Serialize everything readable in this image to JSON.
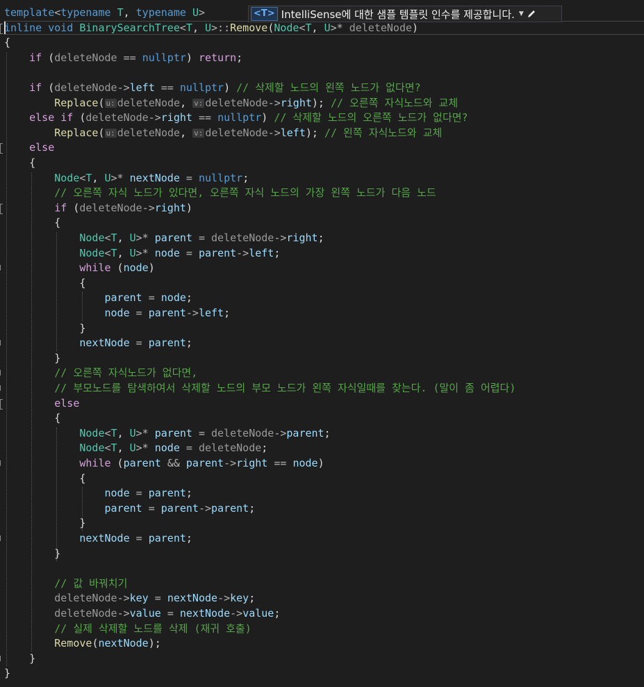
{
  "intellisense": {
    "badge": "<T>",
    "message": "IntelliSense에 대한 샘플 템플릿 인수를 제공합니다."
  },
  "hint_labels": {
    "u": "u:",
    "v": "v:"
  },
  "code": {
    "lines": [
      [
        [
          "kw",
          "template"
        ],
        [
          "op",
          "<"
        ],
        [
          "kw",
          "typename"
        ],
        [
          "pl",
          " "
        ],
        [
          "type",
          "T"
        ],
        [
          "pl",
          ", "
        ],
        [
          "kw",
          "typename"
        ],
        [
          "pl",
          " "
        ],
        [
          "type",
          "U"
        ],
        [
          "op",
          ">"
        ]
      ],
      [
        [
          "kw",
          "inline"
        ],
        [
          "pl",
          " "
        ],
        [
          "kw",
          "void"
        ],
        [
          "pl",
          " "
        ],
        [
          "type",
          "BinarySearchTree"
        ],
        [
          "op",
          "<"
        ],
        [
          "type",
          "T"
        ],
        [
          "pl",
          ", "
        ],
        [
          "type",
          "U"
        ],
        [
          "op",
          ">::"
        ],
        [
          "fn",
          "Remove"
        ],
        [
          "pl",
          "("
        ],
        [
          "type",
          "Node"
        ],
        [
          "op",
          "<"
        ],
        [
          "type",
          "T"
        ],
        [
          "pl",
          ", "
        ],
        [
          "type",
          "U"
        ],
        [
          "op",
          ">*"
        ],
        [
          "pl",
          " "
        ],
        [
          "param",
          "deleteNode"
        ],
        [
          "pl",
          ")"
        ]
      ],
      [
        [
          "pl",
          "{"
        ]
      ],
      [
        [
          "pl",
          "    "
        ],
        [
          "ctrl",
          "if"
        ],
        [
          "pl",
          " ("
        ],
        [
          "param",
          "deleteNode"
        ],
        [
          "pl",
          " "
        ],
        [
          "op",
          "=="
        ],
        [
          "pl",
          " "
        ],
        [
          "kw",
          "nullptr"
        ],
        [
          "pl",
          ") "
        ],
        [
          "ctrl",
          "return"
        ],
        [
          "pl",
          ";"
        ]
      ],
      [],
      [
        [
          "pl",
          "    "
        ],
        [
          "ctrl",
          "if"
        ],
        [
          "pl",
          " ("
        ],
        [
          "param",
          "deleteNode"
        ],
        [
          "op",
          "->"
        ],
        [
          "var",
          "left"
        ],
        [
          "pl",
          " "
        ],
        [
          "op",
          "=="
        ],
        [
          "pl",
          " "
        ],
        [
          "kw",
          "nullptr"
        ],
        [
          "pl",
          ") "
        ],
        [
          "cm",
          "// 삭제할 노드의 왼쪽 노드가 없다면?"
        ]
      ],
      [
        [
          "pl",
          "        "
        ],
        [
          "fn",
          "Replace"
        ],
        [
          "pl",
          "("
        ],
        [
          "hint",
          "u"
        ],
        [
          "param",
          "deleteNode"
        ],
        [
          "pl",
          ", "
        ],
        [
          "hint",
          "v"
        ],
        [
          "param",
          "deleteNode"
        ],
        [
          "op",
          "->"
        ],
        [
          "var",
          "right"
        ],
        [
          "pl",
          "); "
        ],
        [
          "cm",
          "// 오른쪽 자식노드와 교체"
        ]
      ],
      [
        [
          "pl",
          "    "
        ],
        [
          "ctrl",
          "else"
        ],
        [
          "pl",
          " "
        ],
        [
          "ctrl",
          "if"
        ],
        [
          "pl",
          " ("
        ],
        [
          "param",
          "deleteNode"
        ],
        [
          "op",
          "->"
        ],
        [
          "var",
          "right"
        ],
        [
          "pl",
          " "
        ],
        [
          "op",
          "=="
        ],
        [
          "pl",
          " "
        ],
        [
          "kw",
          "nullptr"
        ],
        [
          "pl",
          ") "
        ],
        [
          "cm",
          "// 삭제할 노드의 오른쪽 노드가 없다면?"
        ]
      ],
      [
        [
          "pl",
          "        "
        ],
        [
          "fn",
          "Replace"
        ],
        [
          "pl",
          "("
        ],
        [
          "hint",
          "u"
        ],
        [
          "param",
          "deleteNode"
        ],
        [
          "pl",
          ", "
        ],
        [
          "hint",
          "v"
        ],
        [
          "param",
          "deleteNode"
        ],
        [
          "op",
          "->"
        ],
        [
          "var",
          "left"
        ],
        [
          "pl",
          "); "
        ],
        [
          "cm",
          "// 왼쪽 자식노드와 교체"
        ]
      ],
      [
        [
          "pl",
          "    "
        ],
        [
          "ctrl",
          "else"
        ]
      ],
      [
        [
          "pl",
          "    {"
        ]
      ],
      [
        [
          "pl",
          "        "
        ],
        [
          "type",
          "Node"
        ],
        [
          "op",
          "<"
        ],
        [
          "type",
          "T"
        ],
        [
          "pl",
          ", "
        ],
        [
          "type",
          "U"
        ],
        [
          "op",
          ">*"
        ],
        [
          "pl",
          " "
        ],
        [
          "var",
          "nextNode"
        ],
        [
          "pl",
          " "
        ],
        [
          "op",
          "="
        ],
        [
          "pl",
          " "
        ],
        [
          "kw",
          "nullptr"
        ],
        [
          "pl",
          ";"
        ]
      ],
      [
        [
          "pl",
          "        "
        ],
        [
          "cm",
          "// 오른쪽 자식 노드가 있다면, 오른쪽 자식 노드의 가장 왼쪽 노드가 다음 노드"
        ]
      ],
      [
        [
          "pl",
          "        "
        ],
        [
          "ctrl",
          "if"
        ],
        [
          "pl",
          " ("
        ],
        [
          "param",
          "deleteNode"
        ],
        [
          "op",
          "->"
        ],
        [
          "var",
          "right"
        ],
        [
          "pl",
          ")"
        ]
      ],
      [
        [
          "pl",
          "        {"
        ]
      ],
      [
        [
          "pl",
          "            "
        ],
        [
          "type",
          "Node"
        ],
        [
          "op",
          "<"
        ],
        [
          "type",
          "T"
        ],
        [
          "pl",
          ", "
        ],
        [
          "type",
          "U"
        ],
        [
          "op",
          ">*"
        ],
        [
          "pl",
          " "
        ],
        [
          "var",
          "parent"
        ],
        [
          "pl",
          " "
        ],
        [
          "op",
          "="
        ],
        [
          "pl",
          " "
        ],
        [
          "param",
          "deleteNode"
        ],
        [
          "op",
          "->"
        ],
        [
          "var",
          "right"
        ],
        [
          "pl",
          ";"
        ]
      ],
      [
        [
          "pl",
          "            "
        ],
        [
          "type",
          "Node"
        ],
        [
          "op",
          "<"
        ],
        [
          "type",
          "T"
        ],
        [
          "pl",
          ", "
        ],
        [
          "type",
          "U"
        ],
        [
          "op",
          ">*"
        ],
        [
          "pl",
          " "
        ],
        [
          "var",
          "node"
        ],
        [
          "pl",
          " "
        ],
        [
          "op",
          "="
        ],
        [
          "pl",
          " "
        ],
        [
          "var",
          "parent"
        ],
        [
          "op",
          "->"
        ],
        [
          "var",
          "left"
        ],
        [
          "pl",
          ";"
        ]
      ],
      [
        [
          "pl",
          "            "
        ],
        [
          "ctrl",
          "while"
        ],
        [
          "pl",
          " ("
        ],
        [
          "var",
          "node"
        ],
        [
          "pl",
          ")"
        ]
      ],
      [
        [
          "pl",
          "            {"
        ]
      ],
      [
        [
          "pl",
          "                "
        ],
        [
          "var",
          "parent"
        ],
        [
          "pl",
          " "
        ],
        [
          "op",
          "="
        ],
        [
          "pl",
          " "
        ],
        [
          "var",
          "node"
        ],
        [
          "pl",
          ";"
        ]
      ],
      [
        [
          "pl",
          "                "
        ],
        [
          "var",
          "node"
        ],
        [
          "pl",
          " "
        ],
        [
          "op",
          "="
        ],
        [
          "pl",
          " "
        ],
        [
          "var",
          "parent"
        ],
        [
          "op",
          "->"
        ],
        [
          "var",
          "left"
        ],
        [
          "pl",
          ";"
        ]
      ],
      [
        [
          "pl",
          "            }"
        ]
      ],
      [
        [
          "pl",
          "            "
        ],
        [
          "var",
          "nextNode"
        ],
        [
          "pl",
          " "
        ],
        [
          "op",
          "="
        ],
        [
          "pl",
          " "
        ],
        [
          "var",
          "parent"
        ],
        [
          "pl",
          ";"
        ]
      ],
      [
        [
          "pl",
          "        }"
        ]
      ],
      [
        [
          "pl",
          "        "
        ],
        [
          "cm",
          "// 오른쪽 자식노드가 없다면,"
        ]
      ],
      [
        [
          "pl",
          "        "
        ],
        [
          "cm",
          "// 부모노드를 탐색하여서 삭제할 노드의 부모 노드가 왼쪽 자식일때를 찾는다. (말이 좀 어렵다)"
        ]
      ],
      [
        [
          "pl",
          "        "
        ],
        [
          "ctrl",
          "else"
        ]
      ],
      [
        [
          "pl",
          "        {"
        ]
      ],
      [
        [
          "pl",
          "            "
        ],
        [
          "type",
          "Node"
        ],
        [
          "op",
          "<"
        ],
        [
          "type",
          "T"
        ],
        [
          "pl",
          ", "
        ],
        [
          "type",
          "U"
        ],
        [
          "op",
          ">*"
        ],
        [
          "pl",
          " "
        ],
        [
          "var",
          "parent"
        ],
        [
          "pl",
          " "
        ],
        [
          "op",
          "="
        ],
        [
          "pl",
          " "
        ],
        [
          "param",
          "deleteNode"
        ],
        [
          "op",
          "->"
        ],
        [
          "var",
          "parent"
        ],
        [
          "pl",
          ";"
        ]
      ],
      [
        [
          "pl",
          "            "
        ],
        [
          "type",
          "Node"
        ],
        [
          "op",
          "<"
        ],
        [
          "type",
          "T"
        ],
        [
          "pl",
          ", "
        ],
        [
          "type",
          "U"
        ],
        [
          "op",
          ">*"
        ],
        [
          "pl",
          " "
        ],
        [
          "var",
          "node"
        ],
        [
          "pl",
          " "
        ],
        [
          "op",
          "="
        ],
        [
          "pl",
          " "
        ],
        [
          "param",
          "deleteNode"
        ],
        [
          "pl",
          ";"
        ]
      ],
      [
        [
          "pl",
          "            "
        ],
        [
          "ctrl",
          "while"
        ],
        [
          "pl",
          " ("
        ],
        [
          "var",
          "parent"
        ],
        [
          "pl",
          " "
        ],
        [
          "op",
          "&&"
        ],
        [
          "pl",
          " "
        ],
        [
          "var",
          "parent"
        ],
        [
          "op",
          "->"
        ],
        [
          "var",
          "right"
        ],
        [
          "pl",
          " "
        ],
        [
          "op",
          "=="
        ],
        [
          "pl",
          " "
        ],
        [
          "var",
          "node"
        ],
        [
          "pl",
          ")"
        ]
      ],
      [
        [
          "pl",
          "            {"
        ]
      ],
      [
        [
          "pl",
          "                "
        ],
        [
          "var",
          "node"
        ],
        [
          "pl",
          " "
        ],
        [
          "op",
          "="
        ],
        [
          "pl",
          " "
        ],
        [
          "var",
          "parent"
        ],
        [
          "pl",
          ";"
        ]
      ],
      [
        [
          "pl",
          "                "
        ],
        [
          "var",
          "parent"
        ],
        [
          "pl",
          " "
        ],
        [
          "op",
          "="
        ],
        [
          "pl",
          " "
        ],
        [
          "var",
          "parent"
        ],
        [
          "op",
          "->"
        ],
        [
          "var",
          "parent"
        ],
        [
          "pl",
          ";"
        ]
      ],
      [
        [
          "pl",
          "            }"
        ]
      ],
      [
        [
          "pl",
          "            "
        ],
        [
          "var",
          "nextNode"
        ],
        [
          "pl",
          " "
        ],
        [
          "op",
          "="
        ],
        [
          "pl",
          " "
        ],
        [
          "var",
          "parent"
        ],
        [
          "pl",
          ";"
        ]
      ],
      [
        [
          "pl",
          "        }"
        ]
      ],
      [],
      [
        [
          "pl",
          "        "
        ],
        [
          "cm",
          "// 값 바꿔치기"
        ]
      ],
      [
        [
          "pl",
          "        "
        ],
        [
          "param",
          "deleteNode"
        ],
        [
          "op",
          "->"
        ],
        [
          "var",
          "key"
        ],
        [
          "pl",
          " "
        ],
        [
          "op",
          "="
        ],
        [
          "pl",
          " "
        ],
        [
          "var",
          "nextNode"
        ],
        [
          "op",
          "->"
        ],
        [
          "var",
          "key"
        ],
        [
          "pl",
          ";"
        ]
      ],
      [
        [
          "pl",
          "        "
        ],
        [
          "param",
          "deleteNode"
        ],
        [
          "op",
          "->"
        ],
        [
          "var",
          "value"
        ],
        [
          "pl",
          " "
        ],
        [
          "op",
          "="
        ],
        [
          "pl",
          " "
        ],
        [
          "var",
          "nextNode"
        ],
        [
          "op",
          "->"
        ],
        [
          "var",
          "value"
        ],
        [
          "pl",
          ";"
        ]
      ],
      [
        [
          "pl",
          "        "
        ],
        [
          "cm",
          "// 실제 삭제할 노드를 삭제 (재귀 호출)"
        ]
      ],
      [
        [
          "pl",
          "        "
        ],
        [
          "fn",
          "Remove"
        ],
        [
          "pl",
          "("
        ],
        [
          "var",
          "nextNode"
        ],
        [
          "pl",
          ");"
        ]
      ],
      [
        [
          "pl",
          "    }"
        ]
      ],
      [
        [
          "pl",
          "}"
        ]
      ]
    ]
  },
  "colors": {
    "background": "#1e1e1e",
    "keyword": "#569cd6",
    "control": "#d8a0df",
    "type": "#4ec9b0",
    "function": "#dcdcaa",
    "variable": "#9cdcfe",
    "parameter": "#9a9a9a",
    "comment": "#57a64a"
  }
}
